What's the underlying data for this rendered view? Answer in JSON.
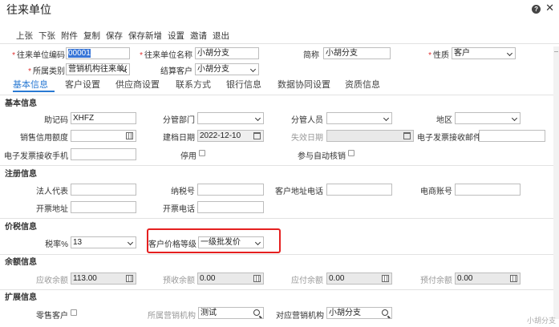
{
  "window": {
    "title": "往来单位"
  },
  "toolbar": {
    "items": [
      "上张",
      "下张",
      "附件",
      "复制",
      "保存",
      "保存新增",
      "设置",
      "邀请",
      "退出"
    ]
  },
  "header_form": {
    "code_label": "往来单位编码",
    "code_value": "00001",
    "name_label": "往来单位名称",
    "name_value": "小胡分支",
    "short_label": "简称",
    "short_value": "小胡分支",
    "nature_label": "性质",
    "nature_value": "客户",
    "category_label": "所属类别",
    "category_value": "营销机构往来单(",
    "settle_label": "结算客户",
    "settle_value": "小胡分支"
  },
  "tabs": [
    "基本信息",
    "客户设置",
    "供应商设置",
    "联系方式",
    "银行信息",
    "数据协同设置",
    "资质信息"
  ],
  "basic": {
    "section": "基本信息",
    "mnemonic_label": "助记码",
    "mnemonic_value": "XHFZ",
    "dept_label": "分管部门",
    "dept_value": "",
    "staff_label": "分管人员",
    "staff_value": "",
    "region_label": "地区",
    "region_value": "",
    "credit_label": "销售信用额度",
    "credit_value": "",
    "created_label": "建档日期",
    "created_value": "2022-12-10",
    "expiry_label": "失效日期",
    "expiry_value": "",
    "einv_email_label": "电子发票接收邮件",
    "einv_email_value": "",
    "einv_phone_label": "电子发票接收手机",
    "einv_phone_value": "",
    "disabled_label": "停用",
    "auto_verify_label": "参与自动核销"
  },
  "registration": {
    "section": "注册信息",
    "legal_label": "法人代表",
    "legal_value": "",
    "tax_label": "纳税号",
    "tax_value": "",
    "addr_phone_label": "客户地址电话",
    "addr_phone_value": "",
    "ecom_label": "电商账号",
    "ecom_value": "",
    "inv_addr_label": "开票地址",
    "inv_addr_value": "",
    "inv_phone_label": "开票电话",
    "inv_phone_value": ""
  },
  "pricing": {
    "section": "价税信息",
    "tax_rate_label": "税率%",
    "tax_rate_value": "13",
    "price_level_label": "客户价格等级",
    "price_level_value": "一级批发价"
  },
  "balance": {
    "section": "余额信息",
    "recv_label": "应收余额",
    "recv_value": "113.00",
    "prerecv_label": "预收余额",
    "prerecv_value": "0.00",
    "pay_label": "应付余额",
    "pay_value": "0.00",
    "prepay_label": "预付余额",
    "prepay_value": "0.00"
  },
  "extension": {
    "section": "扩展信息",
    "retail_label": "零售客户",
    "org_label": "所属营销机构",
    "org_value": "测试",
    "mapped_org_label": "对应营销机构",
    "mapped_org_value": "小胡分支"
  },
  "watermark": "小胡分支"
}
